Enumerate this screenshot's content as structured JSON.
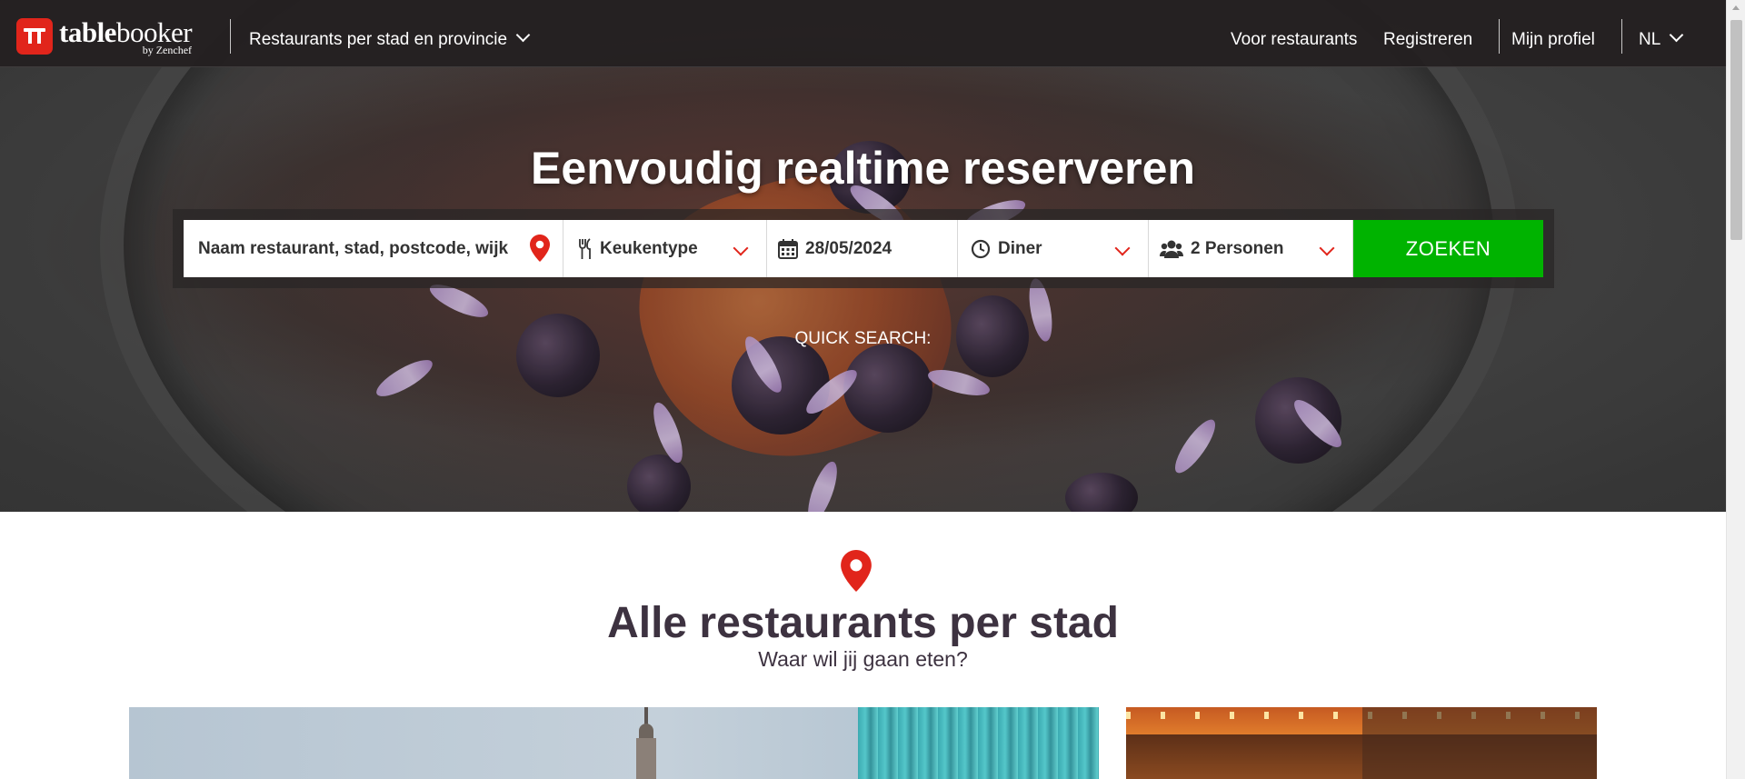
{
  "brand": {
    "name_bold": "table",
    "name_regular": "booker",
    "byline": "by Zenchef",
    "accent_color": "#e1251b"
  },
  "nav": {
    "cities_menu": "Restaurants per stad en provincie",
    "for_restaurants": "Voor restaurants",
    "register": "Registreren",
    "profile": "Mijn profiel",
    "language": "NL"
  },
  "hero": {
    "title": "Eenvoudig realtime reserveren",
    "quick_search": "QUICK SEARCH:"
  },
  "search": {
    "query_placeholder": "Naam restaurant, stad, postcode, wijk",
    "cuisine": "Keukentype",
    "date": "28/05/2024",
    "meal": "Diner",
    "persons": "2 Personen",
    "submit": "ZOEKEN",
    "submit_color": "#00b300"
  },
  "section": {
    "title": "Alle restaurants per stad",
    "subtitle": "Waar wil jij gaan eten?"
  },
  "icons": {
    "location": "map-pin-icon",
    "cuisine": "fork-knife-icon",
    "date": "calendar-icon",
    "meal": "clock-icon",
    "persons": "users-icon"
  }
}
